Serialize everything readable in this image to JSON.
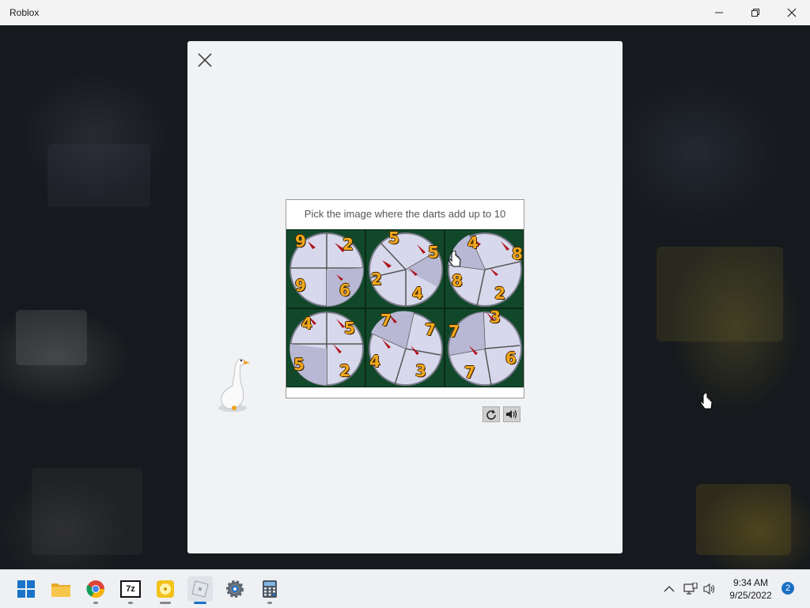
{
  "window": {
    "title": "Roblox"
  },
  "captcha": {
    "prompt": "Pick the image where the darts add up to 10",
    "tiles": [
      {
        "numbers": [
          "9",
          "2",
          "9",
          "6"
        ]
      },
      {
        "numbers": [
          "5",
          "5",
          "2",
          "4"
        ]
      },
      {
        "numbers": [
          "4",
          "8",
          "8",
          "2"
        ]
      },
      {
        "numbers": [
          "4",
          "5",
          "5",
          "2"
        ]
      },
      {
        "numbers": [
          "7",
          "7",
          "4",
          "3"
        ]
      },
      {
        "numbers": [
          "3",
          "7",
          "6",
          "7"
        ]
      }
    ],
    "reload_icon": "reload-icon",
    "audio_icon": "speaker-icon"
  },
  "taskbar": {
    "apps": [
      "windows-start-icon",
      "file-explorer-icon",
      "chrome-icon",
      "7zip-icon",
      "media-player-icon",
      "roblox-icon",
      "settings-icon",
      "calculator-icon"
    ],
    "seven_zip_label": "7z",
    "time": "9:34 AM",
    "date": "9/25/2022",
    "notification_count": "2"
  },
  "colors": {
    "accent": "#1a73c9",
    "digit": "#f2a81d",
    "board_green": "#11482a"
  }
}
